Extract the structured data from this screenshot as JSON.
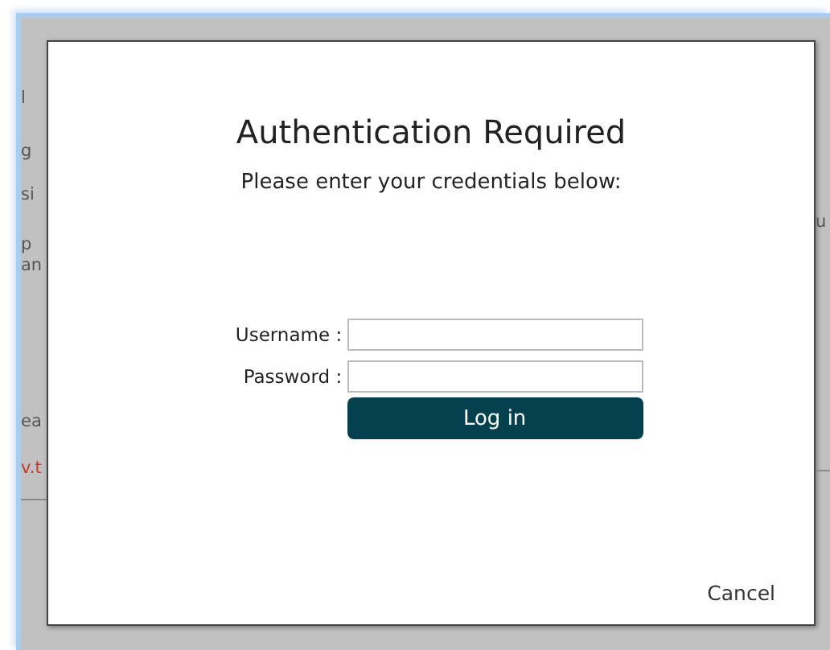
{
  "background": {
    "left_fragments": [
      {
        "text": "l",
        "kind": "text"
      },
      {
        "text": "g",
        "kind": "text"
      },
      {
        "text": "si",
        "kind": "text"
      },
      {
        "text": "p",
        "kind": "text"
      },
      {
        "text": "an",
        "kind": "text"
      },
      {
        "text": "ea",
        "kind": "text"
      },
      {
        "text": "v.t",
        "kind": "link"
      }
    ],
    "right_fragments": [
      {
        "text": "u"
      }
    ]
  },
  "dialog": {
    "title": "Authentication Required",
    "subtitle": "Please enter your credentials below:",
    "fields": [
      {
        "label": "Username :"
      },
      {
        "label": "Password :"
      }
    ],
    "login_button": "Log in",
    "cancel_link": "Cancel"
  }
}
